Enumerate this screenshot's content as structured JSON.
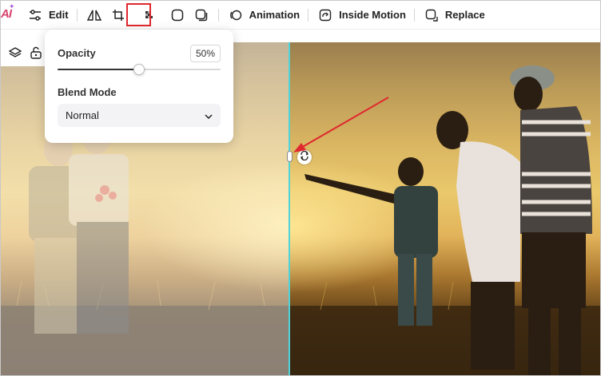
{
  "toolbar": {
    "ai_label": "AI",
    "edit_label": "Edit",
    "animation_label": "Animation",
    "inside_motion_label": "Inside Motion",
    "replace_label": "Replace"
  },
  "opacity_panel": {
    "opacity_label": "Opacity",
    "opacity_value": "50%",
    "opacity_level": 0.5,
    "blend_mode_label": "Blend Mode",
    "blend_mode_value": "Normal"
  },
  "colors": {
    "highlight": "#e0282e",
    "guide": "#4fd3d8",
    "arrow": "#e0282e"
  }
}
